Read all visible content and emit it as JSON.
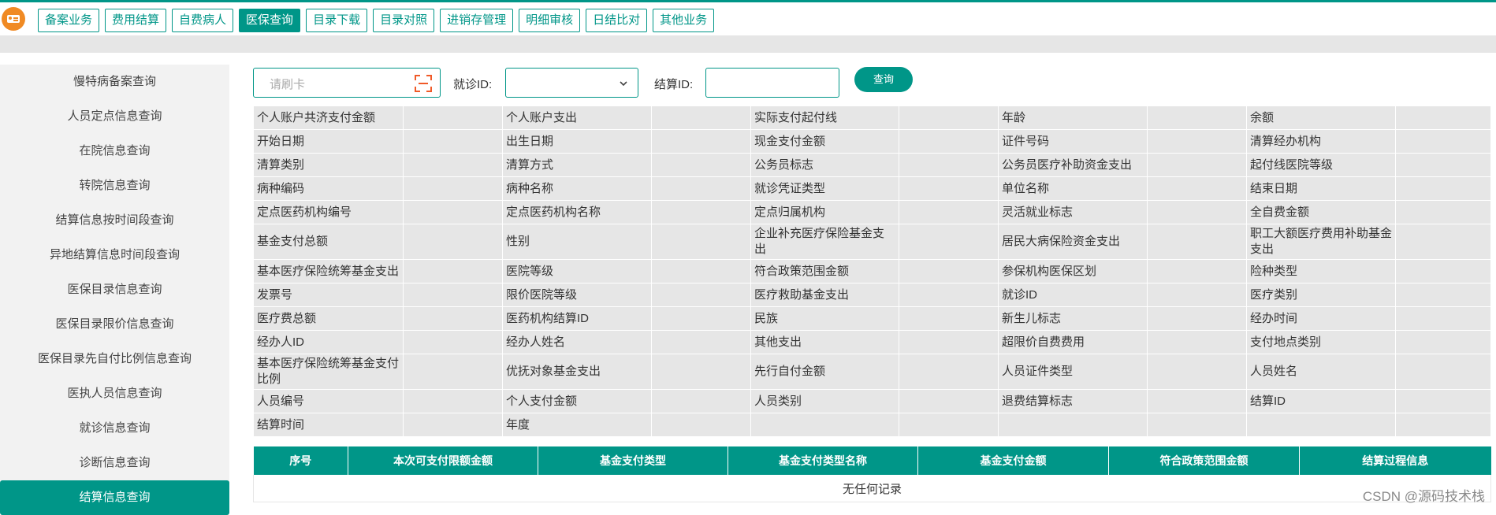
{
  "nav": [
    {
      "label": "备案业务",
      "active": false
    },
    {
      "label": "费用结算",
      "active": false
    },
    {
      "label": "自费病人",
      "active": false
    },
    {
      "label": "医保查询",
      "active": true
    },
    {
      "label": "目录下载",
      "active": false
    },
    {
      "label": "目录对照",
      "active": false
    },
    {
      "label": "进销存管理",
      "active": false
    },
    {
      "label": "明细审核",
      "active": false
    },
    {
      "label": "日结比对",
      "active": false
    },
    {
      "label": "其他业务",
      "active": false
    }
  ],
  "sidebar": [
    {
      "label": "慢特病备案查询"
    },
    {
      "label": "人员定点信息查询"
    },
    {
      "label": "在院信息查询"
    },
    {
      "label": "转院信息查询"
    },
    {
      "label": "结算信息按时间段查询"
    },
    {
      "label": "异地结算信息时间段查询"
    },
    {
      "label": "医保目录信息查询"
    },
    {
      "label": "医保目录限价信息查询"
    },
    {
      "label": "医保目录先自付比例信息查询"
    },
    {
      "label": "医执人员信息查询"
    },
    {
      "label": "就诊信息查询"
    },
    {
      "label": "诊断信息查询"
    },
    {
      "label": "结算信息查询",
      "active": true
    }
  ],
  "form": {
    "card_placeholder": "请刷卡",
    "visit_id_label": "就诊ID:",
    "settle_id_label": "结算ID:",
    "query_label": "查询"
  },
  "info_rows": [
    [
      "个人账户共济支付金额",
      "个人账户支出",
      "实际支付起付线",
      "年龄",
      "余额"
    ],
    [
      "开始日期",
      "出生日期",
      "现金支付金额",
      "证件号码",
      "清算经办机构"
    ],
    [
      "清算类别",
      "清算方式",
      "公务员标志",
      "公务员医疗补助资金支出",
      "起付线医院等级"
    ],
    [
      "病种编码",
      "病种名称",
      "就诊凭证类型",
      "单位名称",
      "结束日期"
    ],
    [
      "定点医药机构编号",
      "定点医药机构名称",
      "定点归属机构",
      "灵活就业标志",
      "全自费金额"
    ],
    [
      "基金支付总额",
      "性别",
      "企业补充医疗保险基金支出",
      "居民大病保险资金支出",
      "职工大额医疗费用补助基金支出"
    ],
    [
      "基本医疗保险统筹基金支出",
      "医院等级",
      "符合政策范围金额",
      "参保机构医保区划",
      "险种类型"
    ],
    [
      "发票号",
      "限价医院等级",
      "医疗救助基金支出",
      "就诊ID",
      "医疗类别"
    ],
    [
      "医疗费总额",
      "医药机构结算ID",
      "民族",
      "新生儿标志",
      "经办时间"
    ],
    [
      "经办人ID",
      "经办人姓名",
      "其他支出",
      "超限价自费费用",
      "支付地点类别"
    ],
    [
      "基本医疗保险统筹基金支付比例",
      "优抚对象基金支出",
      "先行自付金额",
      "人员证件类型",
      "人员姓名"
    ],
    [
      "人员编号",
      "个人支付金额",
      "人员类别",
      "退费结算标志",
      "结算ID"
    ],
    [
      "结算时间",
      "年度",
      "",
      "",
      ""
    ]
  ],
  "grid": {
    "columns": [
      "序号",
      "本次可支付限额金额",
      "基金支付类型",
      "基金支付类型名称",
      "基金支付金额",
      "符合政策范围金额",
      "结算过程信息"
    ],
    "empty_text": "无任何记录"
  },
  "watermark": "CSDN @源码技术栈",
  "colors": {
    "accent": "#009688",
    "logo": "#f08a24",
    "panel": "#e6e6e6"
  }
}
